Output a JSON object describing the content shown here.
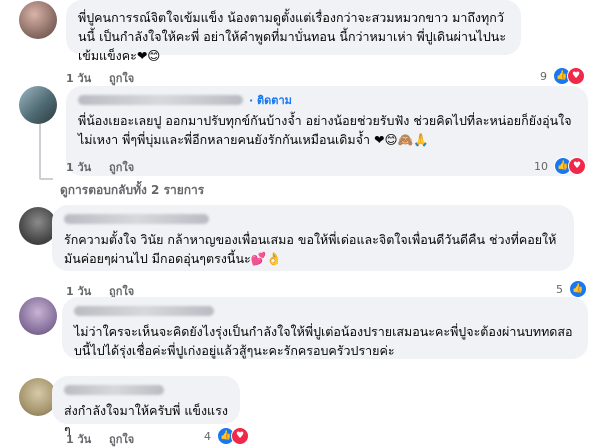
{
  "comments": [
    {
      "text": "พี่ปูคนการรณ์จิตใจเข้มแข็ง น้องตามดูตั้งแต่เรื่องกว่าจะสวมหมวกขาว มาถึงทุกวันนี้ เป็นกำลังใจให้คะพี่ อย่าให้คำพูดที่มาบั่นทอน นี้กว่าหมาเห่า พี่ปูเดินผ่านไปนะ เข้มแข็งคะ❤😊",
      "time": "1 วัน",
      "like": "ถูกใจ",
      "count": "9"
    },
    {
      "follow": "· ติดตาม",
      "text": "พี่น้องเยอะเลยปู ออกมาปรับทุกข์กันบ้างจ้ำ อย่างน้อยช่วยรับฟัง ช่วยคิดไปที่ละหน่อยก็ยังอุ่นใจไม่เหงา พี่ๆพี่บุ่มและพี่อีกหลายคนยังรักกันเหมือนเดิมจ้ำ ❤😊🙈🙏",
      "time": "1 วัน",
      "like": "ถูกใจ",
      "count": "10"
    },
    {
      "text": "รักความตั้งใจ วินัย กล้าหาญของเพื่อนเสมอ ขอให้พี่เด่อและจิตใจเพื่อนดีวันดีคืน ช่วงที่คอยให้มันค่อยๆผ่านไป มีกอดอุ่นๆตรงนี้นะ💕👌",
      "time": "1 วัน",
      "like": "ถูกใจ",
      "count": "5"
    },
    {
      "text": "ไม่ว่าใครจะเห็นจะคิดยังไงรุ่งเป็นกำลังใจให้พี่ปูเต่อน้องปรายเสมอนะคะพี่ปูจะต้องผ่านบททดสอบนี้ไปได้รุ่งเชื่อค่ะพี่ปูเก่งอยู่แล้วสู้ๆนะคะรักครอบครัวปรายค่ะ",
      "time": "",
      "like": "",
      "count": ""
    },
    {
      "text": "ส่งกำลังใจมาให้ครับพี่ แข็งแรงๆ",
      "time": "1 วัน",
      "like": "ถูกใจ",
      "count": "4"
    }
  ],
  "replies_link": "ดูการตอบกลับทั้ง 2 รายการ",
  "colors": {
    "bubble": "#f0f2f5",
    "meta": "#65676b",
    "link": "#1877f2",
    "like": "#1877f2",
    "love": "#f02849"
  },
  "icons": [
    "like-icon",
    "love-icon"
  ]
}
